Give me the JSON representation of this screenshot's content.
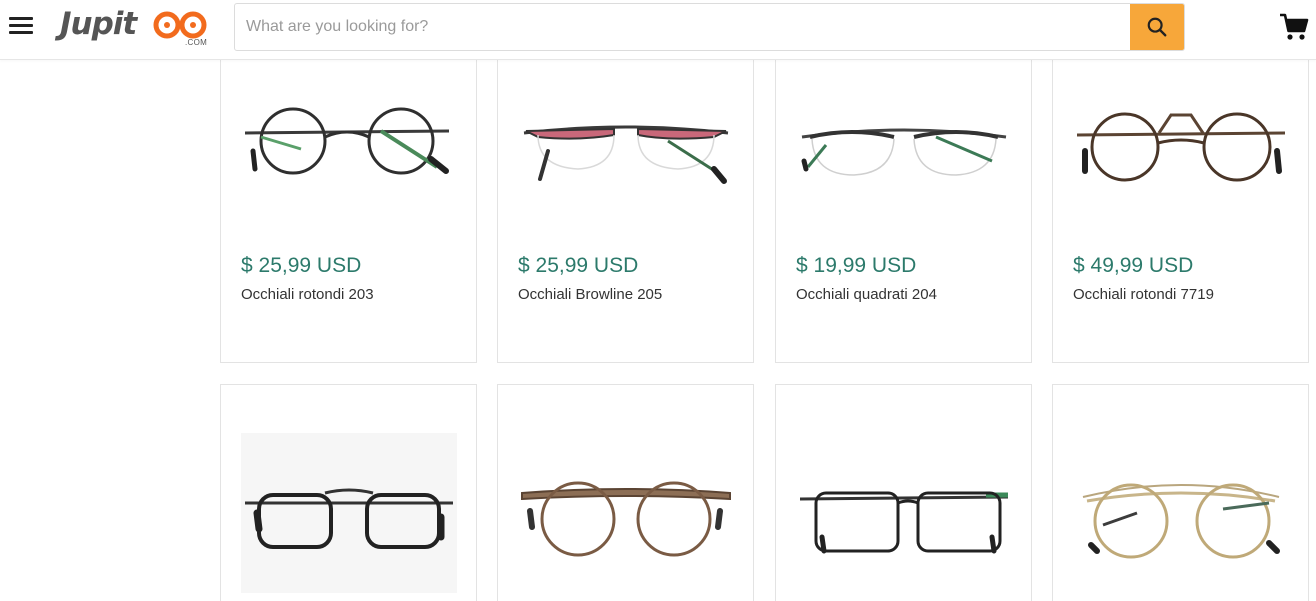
{
  "header": {
    "logo": {
      "text": "Jupit",
      "suffix": ".COM",
      "brand_color": "#f26b1d"
    },
    "search": {
      "placeholder": "What are you looking for?",
      "value": "",
      "button_icon": "search-icon",
      "button_color": "#f7a73a"
    },
    "menu_icon": "hamburger-menu-icon",
    "cart_icon": "shopping-cart-icon"
  },
  "colors": {
    "price": "#2c7a6b",
    "text": "#333333",
    "border": "#e3e3e3"
  },
  "products": [
    {
      "price": "$ 25,99 USD",
      "name": "Occhiali rotondi 203",
      "image": "round-glasses-black"
    },
    {
      "price": "$ 25,99 USD",
      "name": "Occhiali Browline 205",
      "image": "browline-glasses-red"
    },
    {
      "price": "$ 19,99 USD",
      "name": "Occhiali quadrati 204",
      "image": "half-rim-glasses-grey"
    },
    {
      "price": "$ 49,99 USD",
      "name": "Occhiali rotondi 7719",
      "image": "round-glasses-brown-double-bridge"
    },
    {
      "price": "",
      "name": "",
      "image": "aviator-glasses-black"
    },
    {
      "price": "",
      "name": "",
      "image": "round-glasses-bronze"
    },
    {
      "price": "",
      "name": "",
      "image": "square-glasses-black-green"
    },
    {
      "price": "",
      "name": "",
      "image": "round-glasses-gold-double-bridge"
    }
  ]
}
